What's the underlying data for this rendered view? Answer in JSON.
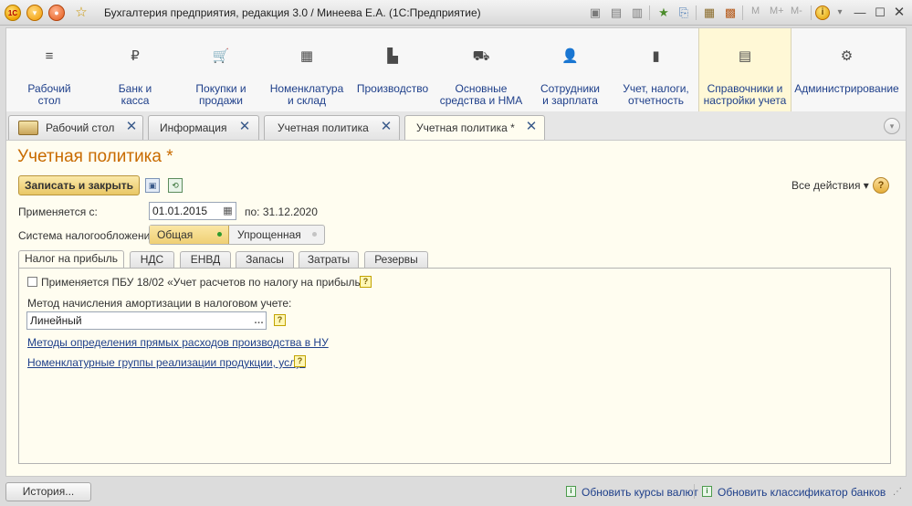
{
  "window": {
    "logo_text": "1С",
    "title": "Бухгалтерия предприятия, редакция 3.0 / Минеева Е.А.  (1С:Предприятие)",
    "mem_buttons": [
      "M",
      "M+",
      "M-"
    ]
  },
  "sections": [
    {
      "label": "Рабочий\nстол",
      "icon": "list-icon",
      "glyph": "≡"
    },
    {
      "label": "Банк и\nкасса",
      "icon": "ruble-icon",
      "glyph": "₽"
    },
    {
      "label": "Покупки и\nпродажи",
      "icon": "cart-icon",
      "glyph": "🛒"
    },
    {
      "label": "Номенклатура\nи склад",
      "icon": "grid-icon",
      "glyph": "▦"
    },
    {
      "label": "Производство",
      "icon": "factory-icon",
      "glyph": "▙"
    },
    {
      "label": "Основные\nсредства и НМА",
      "icon": "truck-icon",
      "glyph": "⛟"
    },
    {
      "label": "Сотрудники\nи зарплата",
      "icon": "person-icon",
      "glyph": "👤"
    },
    {
      "label": "Учет, налоги,\nотчетность",
      "icon": "bar-chart-icon",
      "glyph": "▮"
    },
    {
      "label": "Справочники и\nнастройки учета",
      "icon": "books-icon",
      "glyph": "▤"
    },
    {
      "label": "Администрирование",
      "icon": "gear-icon",
      "glyph": "⚙"
    }
  ],
  "open_tabs": [
    {
      "label": "Рабочий стол"
    },
    {
      "label": "Информация"
    },
    {
      "label": "Учетная политика"
    },
    {
      "label": "Учетная политика *"
    }
  ],
  "form": {
    "title": "Учетная политика *",
    "save_close": "Записать и закрыть",
    "all_actions": "Все действия ▾",
    "help": "?",
    "applies_label": "Применяется с:",
    "applies_value": "01.01.2015",
    "until_text": "по: 31.12.2020",
    "tax_system_label": "Система налогообложения:",
    "tax_options": [
      "Общая",
      "Упрощенная"
    ],
    "inner_tabs": [
      "Налог на прибыль",
      "НДС",
      "ЕНВД",
      "Запасы",
      "Затраты",
      "Резервы"
    ],
    "pbu_checkbox": "Применяется ПБУ 18/02 «Учет расчетов по налогу на прибыль»",
    "amort_label": "Метод начисления амортизации в налоговом учете:",
    "amort_value": "Линейный",
    "link1": "Методы определения прямых расходов производства в НУ",
    "link2": "Номенклатурные группы реализации продукции, услуг"
  },
  "status": {
    "history": "История...",
    "link1": "Обновить курсы валют",
    "link2": "Обновить классификатор банков"
  }
}
